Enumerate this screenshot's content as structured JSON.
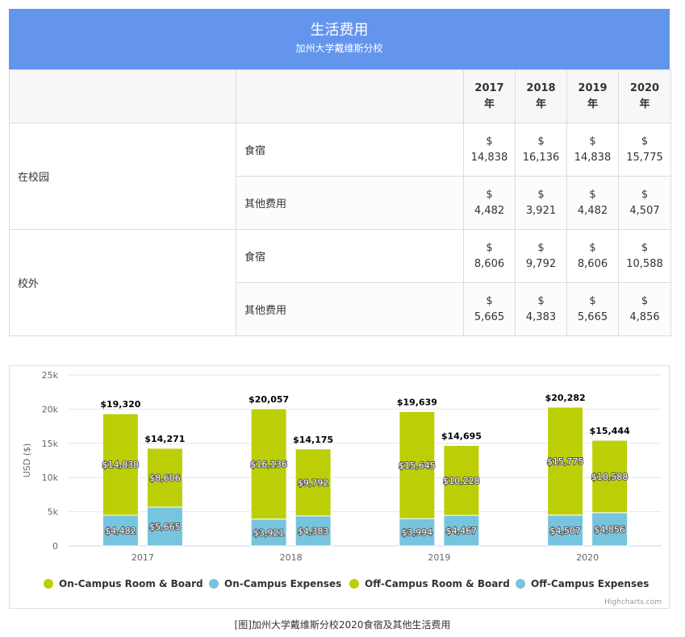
{
  "header": {
    "title": "生活费用",
    "subtitle": "加州大学戴维斯分校"
  },
  "table": {
    "years": [
      {
        "year": "2017",
        "unit": "年"
      },
      {
        "year": "2018",
        "unit": "年"
      },
      {
        "year": "2019",
        "unit": "年"
      },
      {
        "year": "2020",
        "unit": "年"
      }
    ],
    "groups": [
      {
        "name": "在校园",
        "rows": [
          {
            "label": "食宿",
            "cells": [
              "14,838",
              "16,136",
              "14,838",
              "15,775"
            ]
          },
          {
            "label": "其他费用",
            "cells": [
              "4,482",
              "3,921",
              "4,482",
              "4,507"
            ]
          }
        ]
      },
      {
        "name": "校外",
        "rows": [
          {
            "label": "食宿",
            "cells": [
              "8,606",
              "9,792",
              "8,606",
              "10,588"
            ]
          },
          {
            "label": "其他费用",
            "cells": [
              "5,665",
              "4,383",
              "5,665",
              "4,856"
            ]
          }
        ]
      }
    ],
    "currency": "$"
  },
  "chart_data": {
    "type": "bar",
    "stacked": true,
    "categories": [
      "2017",
      "2018",
      "2019",
      "2020"
    ],
    "ylabel": "USD ($)",
    "ylim": [
      0,
      25000
    ],
    "yticks": [
      "0",
      "5k",
      "10k",
      "15k",
      "20k",
      "25k"
    ],
    "series": [
      {
        "name": "On-Campus Room & Board",
        "stack": "on",
        "color": "#bccf06",
        "values": [
          14838,
          16136,
          15645,
          15775
        ]
      },
      {
        "name": "On-Campus Expenses",
        "stack": "on",
        "color": "#76c4de",
        "values": [
          4482,
          3921,
          3994,
          4507
        ]
      },
      {
        "name": "Off-Campus Room & Board",
        "stack": "off",
        "color": "#bccf06",
        "values": [
          8606,
          9792,
          10228,
          10588
        ]
      },
      {
        "name": "Off-Campus Expenses",
        "stack": "off",
        "color": "#76c4de",
        "values": [
          5665,
          4383,
          4467,
          4856
        ]
      }
    ],
    "segment_labels": {
      "on_top": [
        "$14,838",
        "$16,136",
        "$15,645",
        "$15,775"
      ],
      "on_bottom": [
        "$4,482",
        "$3,921",
        "$3,994",
        "$4,507"
      ],
      "off_top": [
        "$8,606",
        "$9,792",
        "$10,228",
        "$10,588"
      ],
      "off_bottom": [
        "$5,665",
        "$4,383",
        "$4,467",
        "$4,856"
      ]
    },
    "totals": {
      "on": [
        "$19,320",
        "$20,057",
        "$19,639",
        "$20,282"
      ],
      "off": [
        "$14,271",
        "$14,175",
        "$14,695",
        "$15,444"
      ]
    },
    "legend_position": "bottom",
    "credit": "Highcharts.com"
  },
  "caption": "[图]加州大学戴维斯分校2020食宿及其他生活费用"
}
